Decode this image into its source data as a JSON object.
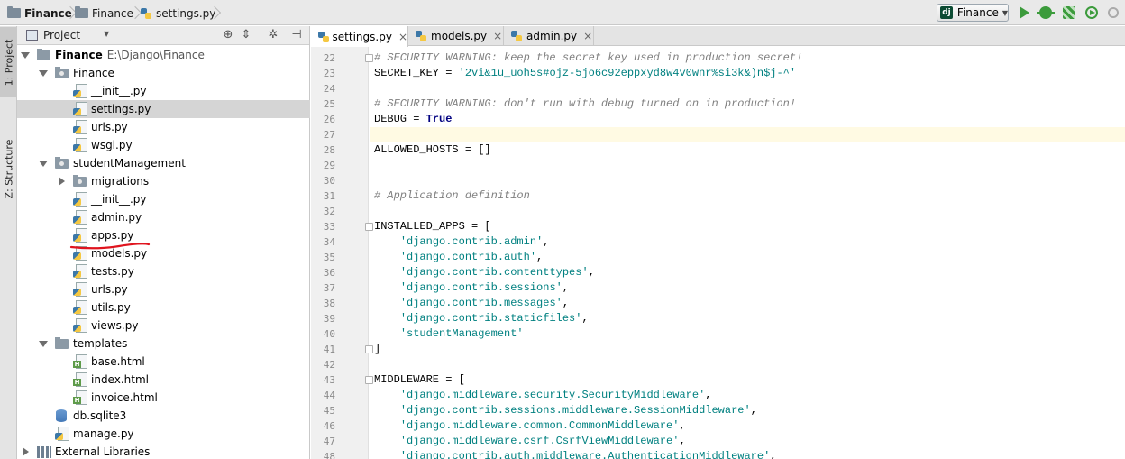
{
  "breadcrumbs": [
    "Finance",
    "Finance",
    "settings.py"
  ],
  "run_config": {
    "label": "Finance",
    "icon": "django-icon"
  },
  "toolbar": {
    "icons": [
      "run-icon",
      "debug-icon",
      "coverage-icon",
      "profile-icon",
      "stop-icon"
    ]
  },
  "side_tabs": {
    "project": "1: Project",
    "structure": "Z: Structure"
  },
  "project_panel": {
    "title": "Project"
  },
  "tree": [
    {
      "label": "Finance",
      "path": "E:\\Django\\Finance",
      "bold": true,
      "type": "folder",
      "depth": 0,
      "arrow": "open"
    },
    {
      "label": "Finance",
      "type": "package",
      "depth": 1,
      "arrow": "open"
    },
    {
      "label": "__init__.py",
      "type": "py",
      "depth": 2
    },
    {
      "label": "settings.py",
      "type": "py",
      "depth": 2,
      "selected": true
    },
    {
      "label": "urls.py",
      "type": "py",
      "depth": 2
    },
    {
      "label": "wsgi.py",
      "type": "py",
      "depth": 2
    },
    {
      "label": "studentManagement",
      "type": "package",
      "depth": 1,
      "arrow": "open"
    },
    {
      "label": "migrations",
      "type": "package",
      "depth": 2,
      "arrow": "closed"
    },
    {
      "label": "__init__.py",
      "type": "py",
      "depth": 2
    },
    {
      "label": "admin.py",
      "type": "py",
      "depth": 2,
      "underlined": true
    },
    {
      "label": "apps.py",
      "type": "py",
      "depth": 2
    },
    {
      "label": "models.py",
      "type": "py",
      "depth": 2
    },
    {
      "label": "tests.py",
      "type": "py",
      "depth": 2
    },
    {
      "label": "urls.py",
      "type": "py",
      "depth": 2
    },
    {
      "label": "utils.py",
      "type": "py",
      "depth": 2
    },
    {
      "label": "views.py",
      "type": "py",
      "depth": 2
    },
    {
      "label": "templates",
      "type": "folder",
      "depth": 1,
      "arrow": "open"
    },
    {
      "label": "base.html",
      "type": "html",
      "depth": 2
    },
    {
      "label": "index.html",
      "type": "html",
      "depth": 2
    },
    {
      "label": "invoice.html",
      "type": "html",
      "depth": 2
    },
    {
      "label": "db.sqlite3",
      "type": "db",
      "depth": 1
    },
    {
      "label": "manage.py",
      "type": "py",
      "depth": 1
    },
    {
      "label": "External Libraries",
      "type": "lib",
      "depth": 0,
      "arrow": "closed"
    }
  ],
  "editor_tabs": [
    {
      "label": "settings.py",
      "active": true
    },
    {
      "label": "models.py",
      "active": false
    },
    {
      "label": "admin.py",
      "active": false
    }
  ],
  "code_lines": [
    {
      "num": "22",
      "fold": true,
      "tokens": [
        {
          "t": "comment",
          "v": "# SECURITY WARNING: keep the secret key used in production secret!"
        }
      ]
    },
    {
      "num": "23",
      "tokens": [
        {
          "t": "plain",
          "v": "SECRET_KEY = "
        },
        {
          "t": "string",
          "v": "'2vi&1u_uoh5s#ojz-5jo6c92eppxyd8w4v0wnr%si3k&)n$j-^'"
        }
      ]
    },
    {
      "num": "24",
      "tokens": []
    },
    {
      "num": "25",
      "tokens": [
        {
          "t": "comment",
          "v": "# SECURITY WARNING: don't run with debug turned on in production!"
        }
      ]
    },
    {
      "num": "26",
      "tokens": [
        {
          "t": "plain",
          "v": "DEBUG = "
        },
        {
          "t": "kw",
          "v": "True"
        }
      ]
    },
    {
      "num": "27",
      "current": true,
      "tokens": []
    },
    {
      "num": "28",
      "tokens": [
        {
          "t": "plain",
          "v": "ALLOWED_HOSTS = []"
        }
      ]
    },
    {
      "num": "29",
      "tokens": []
    },
    {
      "num": "30",
      "tokens": []
    },
    {
      "num": "31",
      "tokens": [
        {
          "t": "comment",
          "v": "# Application definition"
        }
      ]
    },
    {
      "num": "32",
      "tokens": []
    },
    {
      "num": "33",
      "fold": true,
      "tokens": [
        {
          "t": "plain",
          "v": "INSTALLED_APPS = ["
        }
      ]
    },
    {
      "num": "34",
      "tokens": [
        {
          "t": "plain",
          "v": "    "
        },
        {
          "t": "string",
          "v": "'django.contrib.admin'"
        },
        {
          "t": "plain",
          "v": ","
        }
      ]
    },
    {
      "num": "35",
      "tokens": [
        {
          "t": "plain",
          "v": "    "
        },
        {
          "t": "string",
          "v": "'django.contrib.auth'"
        },
        {
          "t": "plain",
          "v": ","
        }
      ]
    },
    {
      "num": "36",
      "tokens": [
        {
          "t": "plain",
          "v": "    "
        },
        {
          "t": "string",
          "v": "'django.contrib.contenttypes'"
        },
        {
          "t": "plain",
          "v": ","
        }
      ]
    },
    {
      "num": "37",
      "tokens": [
        {
          "t": "plain",
          "v": "    "
        },
        {
          "t": "string",
          "v": "'django.contrib.sessions'"
        },
        {
          "t": "plain",
          "v": ","
        }
      ]
    },
    {
      "num": "38",
      "tokens": [
        {
          "t": "plain",
          "v": "    "
        },
        {
          "t": "string",
          "v": "'django.contrib.messages'"
        },
        {
          "t": "plain",
          "v": ","
        }
      ]
    },
    {
      "num": "39",
      "tokens": [
        {
          "t": "plain",
          "v": "    "
        },
        {
          "t": "string",
          "v": "'django.contrib.staticfiles'"
        },
        {
          "t": "plain",
          "v": ","
        }
      ]
    },
    {
      "num": "40",
      "tokens": [
        {
          "t": "plain",
          "v": "    "
        },
        {
          "t": "string",
          "v": "'studentManagement'"
        }
      ]
    },
    {
      "num": "41",
      "fold": true,
      "tokens": [
        {
          "t": "plain",
          "v": "]"
        }
      ]
    },
    {
      "num": "42",
      "tokens": []
    },
    {
      "num": "43",
      "fold": true,
      "tokens": [
        {
          "t": "plain",
          "v": "MIDDLEWARE = ["
        }
      ]
    },
    {
      "num": "44",
      "tokens": [
        {
          "t": "plain",
          "v": "    "
        },
        {
          "t": "string",
          "v": "'django.middleware.security.SecurityMiddleware'"
        },
        {
          "t": "plain",
          "v": ","
        }
      ]
    },
    {
      "num": "45",
      "tokens": [
        {
          "t": "plain",
          "v": "    "
        },
        {
          "t": "string",
          "v": "'django.contrib.sessions.middleware.SessionMiddleware'"
        },
        {
          "t": "plain",
          "v": ","
        }
      ]
    },
    {
      "num": "46",
      "tokens": [
        {
          "t": "plain",
          "v": "    "
        },
        {
          "t": "string",
          "v": "'django.middleware.common.CommonMiddleware'"
        },
        {
          "t": "plain",
          "v": ","
        }
      ]
    },
    {
      "num": "47",
      "tokens": [
        {
          "t": "plain",
          "v": "    "
        },
        {
          "t": "string",
          "v": "'django.middleware.csrf.CsrfViewMiddleware'"
        },
        {
          "t": "plain",
          "v": ","
        }
      ]
    },
    {
      "num": "48",
      "tokens": [
        {
          "t": "plain",
          "v": "    "
        },
        {
          "t": "string",
          "v": "'django.contrib.auth.middleware.AuthenticationMiddleware'"
        },
        {
          "t": "plain",
          "v": ","
        }
      ]
    }
  ],
  "colors": {
    "comment": "#808080",
    "string": "#008080",
    "keyword": "#000080",
    "current_line": "#fffae3",
    "selection": "#d5d5d5",
    "annotation": "#e0141e"
  }
}
